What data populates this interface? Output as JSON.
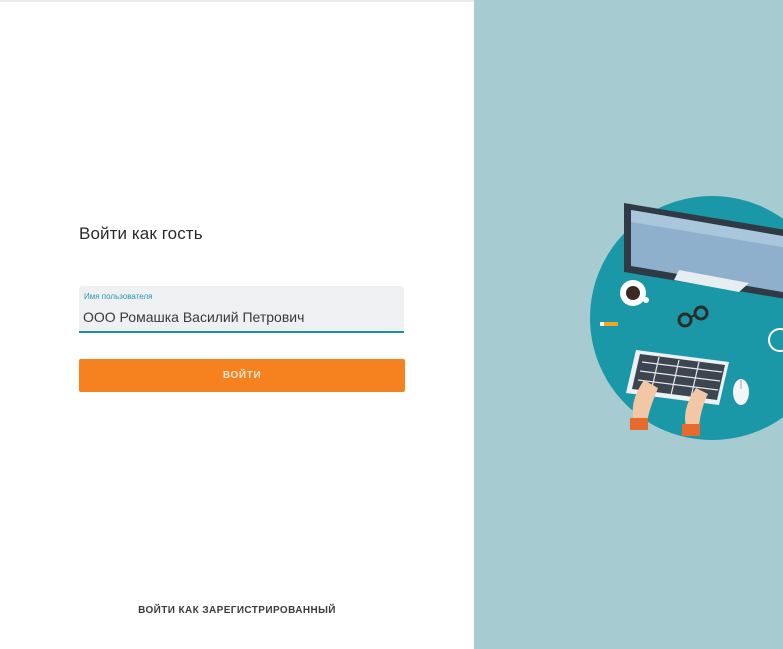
{
  "guest_login": {
    "title": "Войти как гость",
    "username_field": {
      "label": "Имя пользователя",
      "value": "ООО Ромашка Василий Петрович"
    },
    "login_button": "ВОЙТИ",
    "register_link": "ВОЙТИ КАК ЗАРЕГИСТРИРОВАННЫЙ"
  },
  "illustration": {
    "name": "workspace-illustration",
    "background_color": "#a6cbd0",
    "circle_color": "#1a98a7"
  },
  "colors": {
    "accent": "#f5811f",
    "field_underline": "#1f8fa6",
    "field_label": "#2a97b0"
  }
}
